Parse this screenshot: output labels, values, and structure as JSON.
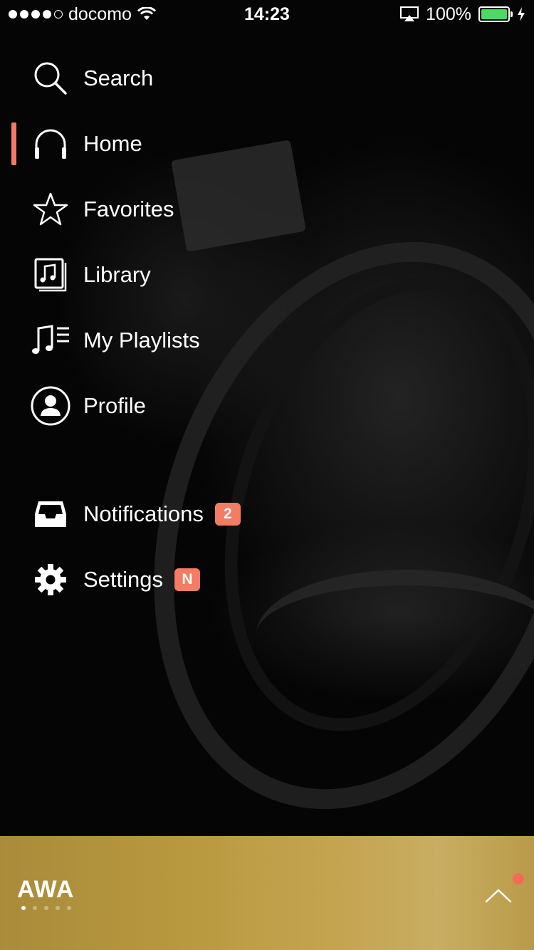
{
  "status_bar": {
    "carrier": "docomo",
    "time": "14:23",
    "battery": "100%"
  },
  "menu": {
    "items": [
      {
        "label": "Search",
        "icon": "search-icon"
      },
      {
        "label": "Home",
        "icon": "headphones-icon",
        "active": true
      },
      {
        "label": "Favorites",
        "icon": "star-icon"
      },
      {
        "label": "Library",
        "icon": "library-icon"
      },
      {
        "label": "My Playlists",
        "icon": "playlist-icon"
      },
      {
        "label": "Profile",
        "icon": "profile-icon"
      },
      {
        "label": "Notifications",
        "icon": "inbox-icon",
        "badge": "2"
      },
      {
        "label": "Settings",
        "icon": "gear-icon",
        "badge": "N"
      }
    ]
  },
  "player": {
    "logo": "AWA"
  },
  "colors": {
    "accent": "#f47b64",
    "player_bar": "#b9993f",
    "battery": "#4cd964"
  }
}
